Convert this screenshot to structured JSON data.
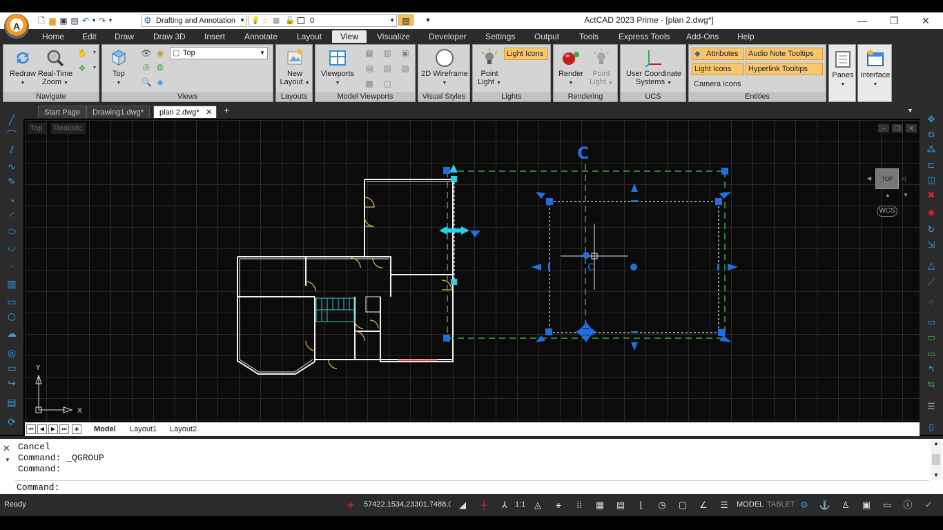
{
  "app": {
    "title": "ActCAD 2023 Prime - [plan 2.dwg*]",
    "logo_letter": "A"
  },
  "quick_access": {
    "workspace": "Drafting and Annotation",
    "layer": "0"
  },
  "menu": {
    "tabs": [
      "Home",
      "Edit",
      "Draw",
      "Draw 3D",
      "Insert",
      "Annotate",
      "Layout",
      "View",
      "Visualize",
      "Developer",
      "Settings",
      "Output",
      "Tools",
      "Express Tools",
      "Add-Ons",
      "Help"
    ],
    "active": "View"
  },
  "ribbon": {
    "navigate": {
      "title": "Navigate",
      "redraw": "Redraw",
      "realtime_zoom": "Real-Time Zoom"
    },
    "views": {
      "title": "Views",
      "top_button": "Top",
      "view_select": "Top"
    },
    "layouts": {
      "title": "Layouts",
      "new_layout": "New Layout"
    },
    "model_viewports": {
      "title": "Model Viewports",
      "viewports": "Viewports"
    },
    "visual_styles": {
      "title": "Visual Styles",
      "wireframe": "2D Wireframe"
    },
    "lights": {
      "title": "Lights",
      "point_light": "Point Light",
      "light_icons": "Light Icons"
    },
    "rendering": {
      "title": "Rendering",
      "render": "Render",
      "point_light": "Point Light"
    },
    "ucs": {
      "title": "UCS",
      "user_coordinate_systems": "User Coordinate Systems"
    },
    "entities": {
      "title": "Entities",
      "attributes": "Attributes",
      "audio_note_tooltips": "Audio Note Tooltips",
      "light_icons": "Light Icons",
      "hyperlink_tooltips": "Hyperlink Tooltips",
      "camera_icons": "Camera Icons"
    },
    "panes": "Panes",
    "interface": "Interface"
  },
  "doc_tabs": [
    "Start Page",
    "Drawing1.dwg*",
    "plan 2.dwg*"
  ],
  "doc_tab_active": "plan 2.dwg*",
  "viewport": {
    "view_label": "Top",
    "style_label": "Realistic",
    "navcube": "TOP",
    "wcs": "WCS",
    "axis_x": "X",
    "axis_y": "Y"
  },
  "layout_tabs": [
    "Model",
    "Layout1",
    "Layout2"
  ],
  "command": {
    "history": [
      "Cancel",
      "Command: _QGROUP",
      "Command:"
    ],
    "prompt": "Command:"
  },
  "status": {
    "ready": "Ready",
    "coords": "57422.1534,23301.7488,0",
    "scale": "1:1",
    "model": "MODEL",
    "tablet": "TABLET"
  },
  "colors": {
    "accent_blue": "#2f8fe8",
    "grip_blue": "#1f6fe0",
    "selection_green": "#3fa843",
    "ribbon_orange": "#f9c66d"
  }
}
